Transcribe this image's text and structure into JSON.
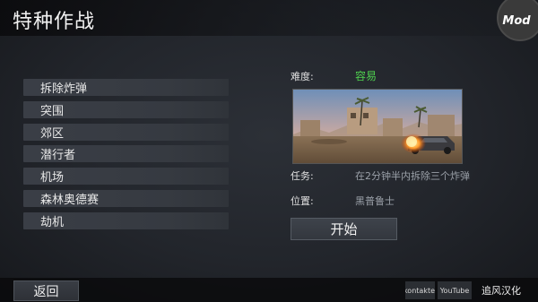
{
  "header": {
    "title": "特种作战",
    "mod_badge": "Mod"
  },
  "missions": [
    {
      "label": "拆除炸弹"
    },
    {
      "label": "突围"
    },
    {
      "label": "郊区"
    },
    {
      "label": "潜行者"
    },
    {
      "label": "机场"
    },
    {
      "label": "森林奥德赛"
    },
    {
      "label": "劫机"
    }
  ],
  "details": {
    "difficulty_label": "难度:",
    "difficulty_value": "容易",
    "difficulty_color": "#4fd14f",
    "preview_icon": "desert-town-burning-car",
    "task_label": "任务:",
    "task_value": "在2分钟半内拆除三个炸弹",
    "location_label": "位置:",
    "location_value": "黑普鲁士"
  },
  "actions": {
    "start_label": "开始",
    "back_label": "返回"
  },
  "footer": {
    "vk_label": "Vkontakte",
    "youtube_label": "YouTube",
    "localizer_label": "追风汉化"
  }
}
